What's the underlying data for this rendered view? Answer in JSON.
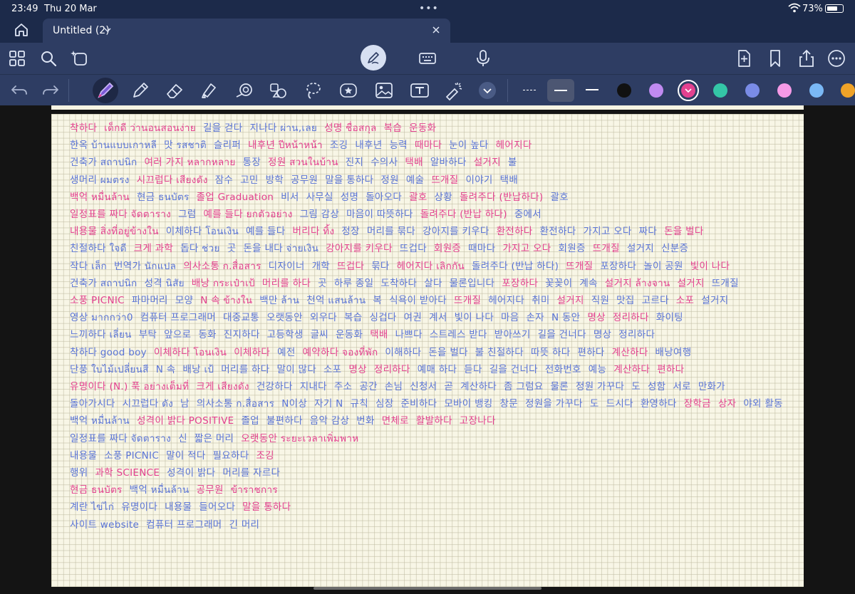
{
  "status_bar": {
    "time": "23:49",
    "date": "Thu 20 Mar",
    "battery_text": "73%",
    "battery_level": 0.73
  },
  "tab": {
    "title": "Untitled (2)"
  },
  "icons": {
    "home": "home-icon",
    "grid": "grid-icon",
    "search": "search-icon",
    "magic": "ai-icon",
    "pen_mode": "pen-icon",
    "keyboard": "keyboard-icon",
    "mic": "microphone-icon",
    "add_page": "add-page-icon",
    "bookmark": "bookmark-icon",
    "share": "share-icon",
    "more": "more-icon"
  },
  "tools": [
    "undo",
    "redo",
    "pen",
    "pencil",
    "eraser",
    "highlighter",
    "shapes",
    "elements",
    "lasso",
    "stickers",
    "image",
    "text",
    "laser"
  ],
  "stroke_widths": [
    "fine",
    "medium",
    "thick"
  ],
  "colors": {
    "black": "#111111",
    "purple": "#c08af0",
    "pink": "#e3418f",
    "teal": "#34c6a7",
    "periwinkle": "#7a8ce6",
    "light_pink": "#f59ae6",
    "light_blue": "#7ab8f5",
    "orange": "#f0a328",
    "selected": "pink",
    "ink_blue": "#5a74d6",
    "ink_pink": "#e3418f",
    "paper": "#f8f6e6"
  },
  "notes": [
    [
      {
        "t": "착하다",
        "c": "pk"
      },
      {
        "t": "เด็กดี ว่านอนสอนง่าย",
        "c": "pk"
      },
      {
        "t": "길을 걷다",
        "c": "bl"
      },
      {
        "t": "지나다 ผ่าน,เลย",
        "c": "bl"
      },
      {
        "t": "성명 ชื่อสกุล",
        "c": "pk"
      },
      {
        "t": "복습",
        "c": "pk"
      },
      {
        "t": "운동화",
        "c": "pk"
      }
    ],
    [
      {
        "t": "한옥 บ้านแบบเกาหลี",
        "c": "bl"
      },
      {
        "t": "맛 รสชาติ",
        "c": "bl"
      },
      {
        "t": "슬리퍼",
        "c": "bl"
      },
      {
        "t": "내후년 ปีหน้าหน้า",
        "c": "pk"
      },
      {
        "t": "조깅",
        "c": "bl"
      },
      {
        "t": "내후년",
        "c": "bl"
      },
      {
        "t": "능력",
        "c": "bl"
      },
      {
        "t": "때마다",
        "c": "pk"
      },
      {
        "t": "눈이 높다",
        "c": "bl"
      },
      {
        "t": "헤어지다",
        "c": "pk"
      }
    ],
    [
      {
        "t": "건축가 สถาปนิก",
        "c": "bl"
      },
      {
        "t": "여러 가지 หลากหลาย",
        "c": "pk"
      },
      {
        "t": "통장",
        "c": "bl"
      },
      {
        "t": "정원 สวนในบ้าน",
        "c": "pk"
      },
      {
        "t": "진지",
        "c": "bl"
      },
      {
        "t": "수의사",
        "c": "bl"
      },
      {
        "t": "택배",
        "c": "pk"
      },
      {
        "t": "알바하다",
        "c": "bl"
      },
      {
        "t": "설거지",
        "c": "pk"
      },
      {
        "t": "불",
        "c": "bl"
      }
    ],
    [
      {
        "t": "생머리 ผมตรง",
        "c": "bl"
      },
      {
        "t": "시끄럽다 เสียงดัง",
        "c": "pk"
      },
      {
        "t": "잠수",
        "c": "bl"
      },
      {
        "t": "고민",
        "c": "bl"
      },
      {
        "t": "방학",
        "c": "bl"
      },
      {
        "t": "공무원",
        "c": "bl"
      },
      {
        "t": "말을 통하다",
        "c": "bl"
      },
      {
        "t": "정원",
        "c": "bl"
      },
      {
        "t": "예술",
        "c": "bl"
      },
      {
        "t": "뜨개질",
        "c": "pk"
      },
      {
        "t": "이야기",
        "c": "bl"
      },
      {
        "t": "택배",
        "c": "bl"
      }
    ],
    [
      {
        "t": "백억 หมื่นล้าน",
        "c": "pk"
      },
      {
        "t": "현금 ธนบัตร",
        "c": "bl"
      },
      {
        "t": "졸업 Graduation",
        "c": "pk"
      },
      {
        "t": "비서",
        "c": "bl"
      },
      {
        "t": "사무실",
        "c": "bl"
      },
      {
        "t": "성명",
        "c": "bl"
      },
      {
        "t": "돌아오다",
        "c": "bl"
      },
      {
        "t": "괄호",
        "c": "pk"
      },
      {
        "t": "상황",
        "c": "bl"
      },
      {
        "t": "돌려주다 (반납하다)",
        "c": "pk"
      },
      {
        "t": "괄호",
        "c": "bl"
      }
    ],
    [
      {
        "t": "일정표를 짜다 จัดตาราง",
        "c": "pk"
      },
      {
        "t": "그럼",
        "c": "bl"
      },
      {
        "t": "예를 들다 ยกตัวอย่าง",
        "c": "pk"
      },
      {
        "t": "그림 감상",
        "c": "bl"
      },
      {
        "t": "마음이 따뜻하다",
        "c": "bl"
      },
      {
        "t": "돌려주다 (반납 하다)",
        "c": "pk"
      },
      {
        "t": "중에서",
        "c": "bl"
      }
    ],
    [
      {
        "t": "내용물 สิ่งที่อยู่ข้างใน",
        "c": "pk"
      },
      {
        "t": "이체하다 โอนเงิน",
        "c": "bl"
      },
      {
        "t": "예를 들다",
        "c": "bl"
      },
      {
        "t": "버리다 ทิ้ง",
        "c": "pk"
      },
      {
        "t": "정장",
        "c": "bl"
      },
      {
        "t": "머리를 묶다",
        "c": "bl"
      },
      {
        "t": "강아지를 키우다",
        "c": "bl"
      },
      {
        "t": "환전하다",
        "c": "pk"
      },
      {
        "t": "환전하다",
        "c": "bl"
      },
      {
        "t": "가지고 오다",
        "c": "bl"
      },
      {
        "t": "짜다",
        "c": "bl"
      },
      {
        "t": "돈을 벌다",
        "c": "pk"
      }
    ],
    [
      {
        "t": "친절하다 ใจดี",
        "c": "bl"
      },
      {
        "t": "크게 과학",
        "c": "pk"
      },
      {
        "t": "돕다 ช่วย",
        "c": "bl"
      },
      {
        "t": "곳",
        "c": "bl"
      },
      {
        "t": "돈을 내다 จ่ายเงิน",
        "c": "bl"
      },
      {
        "t": "강아지를 키우다",
        "c": "pk"
      },
      {
        "t": "뜨겁다",
        "c": "bl"
      },
      {
        "t": "회원증",
        "c": "pk"
      },
      {
        "t": "때마다",
        "c": "bl"
      },
      {
        "t": "가지고 오다",
        "c": "pk"
      },
      {
        "t": "회원증",
        "c": "bl"
      },
      {
        "t": "뜨개질",
        "c": "pk"
      },
      {
        "t": "설거지",
        "c": "bl"
      },
      {
        "t": "신분증",
        "c": "bl"
      }
    ],
    [
      {
        "t": "작다 เล็ก",
        "c": "bl"
      },
      {
        "t": "번역가 นักแปล",
        "c": "bl"
      },
      {
        "t": "의사소통 ก.สื่อสาร",
        "c": "pk"
      },
      {
        "t": "디자이너",
        "c": "bl"
      },
      {
        "t": "개학",
        "c": "bl"
      },
      {
        "t": "뜨겁다",
        "c": "pk"
      },
      {
        "t": "묶다",
        "c": "bl"
      },
      {
        "t": "헤어지다 เลิกกัน",
        "c": "pk"
      },
      {
        "t": "돌려주다 (반납 하다)",
        "c": "bl"
      },
      {
        "t": "뜨개질",
        "c": "pk"
      },
      {
        "t": "포장하다",
        "c": "bl"
      },
      {
        "t": "놀이 공원",
        "c": "bl"
      },
      {
        "t": "빛이 나다",
        "c": "pk"
      }
    ],
    [
      {
        "t": "건축가 สถาปนิก",
        "c": "bl"
      },
      {
        "t": "성격 นิสัย",
        "c": "bl"
      },
      {
        "t": "배낭 กระเป๋าเป้",
        "c": "pk"
      },
      {
        "t": "머리를 하다",
        "c": "pk"
      },
      {
        "t": "곳",
        "c": "bl"
      },
      {
        "t": "하루 종일",
        "c": "bl"
      },
      {
        "t": "도착하다",
        "c": "bl"
      },
      {
        "t": "살다",
        "c": "bl"
      },
      {
        "t": "물론입니다",
        "c": "bl"
      },
      {
        "t": "포장하다",
        "c": "pk"
      },
      {
        "t": "꽃꽂이",
        "c": "bl"
      },
      {
        "t": "계속",
        "c": "bl"
      },
      {
        "t": "설거지 ล้างจาน",
        "c": "pk"
      },
      {
        "t": "설거지",
        "c": "pk"
      },
      {
        "t": "뜨개질",
        "c": "bl"
      }
    ],
    [
      {
        "t": "소풍 PICNIC",
        "c": "pk"
      },
      {
        "t": "파마머리",
        "c": "bl"
      },
      {
        "t": "모양",
        "c": "bl"
      },
      {
        "t": "N 속 ข้างใน",
        "c": "pk"
      },
      {
        "t": "백만 ล้าน",
        "c": "bl"
      },
      {
        "t": "천억 แสนล้าน",
        "c": "bl"
      },
      {
        "t": "복",
        "c": "bl"
      },
      {
        "t": "식욕이 받아다",
        "c": "bl"
      },
      {
        "t": "뜨개질",
        "c": "pk"
      },
      {
        "t": "헤어지다",
        "c": "bl"
      },
      {
        "t": "취미",
        "c": "bl"
      },
      {
        "t": "설거지",
        "c": "pk"
      },
      {
        "t": "직원",
        "c": "bl"
      },
      {
        "t": "맛집",
        "c": "bl"
      },
      {
        "t": "고르다",
        "c": "bl"
      },
      {
        "t": "소포",
        "c": "pk"
      },
      {
        "t": "설거지",
        "c": "bl"
      }
    ],
    [
      {
        "t": "영상 มากกว่า0",
        "c": "bl"
      },
      {
        "t": "컴퓨터 프로그래머",
        "c": "bl"
      },
      {
        "t": "대중교통",
        "c": "bl"
      },
      {
        "t": "오랫동안",
        "c": "bl"
      },
      {
        "t": "외우다",
        "c": "bl"
      },
      {
        "t": "복습",
        "c": "bl"
      },
      {
        "t": "싱겁다",
        "c": "bl"
      },
      {
        "t": "여권",
        "c": "bl"
      },
      {
        "t": "계서",
        "c": "bl"
      },
      {
        "t": "빛이 나다",
        "c": "bl"
      },
      {
        "t": "마음",
        "c": "bl"
      },
      {
        "t": "손자",
        "c": "bl"
      },
      {
        "t": "N 동안",
        "c": "bl"
      },
      {
        "t": "명상",
        "c": "pk"
      },
      {
        "t": "정리하다",
        "c": "pk"
      },
      {
        "t": "화이팅",
        "c": "bl"
      }
    ],
    [
      {
        "t": "느끼하다 เลี่ยน",
        "c": "bl"
      },
      {
        "t": "부탁",
        "c": "bl"
      },
      {
        "t": "앞으로",
        "c": "bl"
      },
      {
        "t": "동화",
        "c": "bl"
      },
      {
        "t": "진지하다",
        "c": "bl"
      },
      {
        "t": "고등학생",
        "c": "bl"
      },
      {
        "t": "글씨",
        "c": "bl"
      },
      {
        "t": "운동화",
        "c": "bl"
      },
      {
        "t": "택배",
        "c": "pk"
      },
      {
        "t": "나쁘다",
        "c": "bl"
      },
      {
        "t": "스트레스 받다",
        "c": "bl"
      },
      {
        "t": "받아쓰기",
        "c": "bl"
      },
      {
        "t": "길을 건너다",
        "c": "bl"
      },
      {
        "t": "명상",
        "c": "bl"
      },
      {
        "t": "정리하다",
        "c": "bl"
      }
    ],
    [
      {
        "t": "착하다 good boy",
        "c": "bl"
      },
      {
        "t": "이체하다 โอนเงิน",
        "c": "pk"
      },
      {
        "t": "이체하다",
        "c": "pk"
      },
      {
        "t": "예전",
        "c": "bl"
      },
      {
        "t": "예약하다 จองที่พัก",
        "c": "pk"
      },
      {
        "t": "이해하다",
        "c": "bl"
      },
      {
        "t": "돈을 벌다",
        "c": "bl"
      },
      {
        "t": "불 친절하다",
        "c": "bl"
      },
      {
        "t": "따뜻 하다",
        "c": "bl"
      },
      {
        "t": "편하다",
        "c": "bl"
      },
      {
        "t": "계산하다",
        "c": "pk"
      },
      {
        "t": "배낭여행",
        "c": "bl"
      }
    ],
    [
      {
        "t": "단풍 ใบไม้เปลี่ยนสี",
        "c": "bl"
      },
      {
        "t": "N 속",
        "c": "bl"
      },
      {
        "t": "배낭 เป้",
        "c": "bl"
      },
      {
        "t": "머리를 하다",
        "c": "bl"
      },
      {
        "t": "말이 많다",
        "c": "bl"
      },
      {
        "t": "소포",
        "c": "bl"
      },
      {
        "t": "명상",
        "c": "pk"
      },
      {
        "t": "정리하다",
        "c": "pk"
      },
      {
        "t": "예매 하다",
        "c": "bl"
      },
      {
        "t": "듣다",
        "c": "bl"
      },
      {
        "t": "길을 건너다",
        "c": "bl"
      },
      {
        "t": "전화번호",
        "c": "bl"
      },
      {
        "t": "예능",
        "c": "bl"
      },
      {
        "t": "계산하다",
        "c": "pk"
      },
      {
        "t": "편하다",
        "c": "pk"
      }
    ],
    [
      {
        "t": "유명이다 (N.) 푹 อย่างเต็มที่",
        "c": "pk"
      },
      {
        "t": "크게 เสียงดัง",
        "c": "pk"
      },
      {
        "t": "건강하다",
        "c": "bl"
      },
      {
        "t": "지내다",
        "c": "bl"
      },
      {
        "t": "주소",
        "c": "bl"
      },
      {
        "t": "공간",
        "c": "bl"
      },
      {
        "t": "손님",
        "c": "bl"
      },
      {
        "t": "신청서",
        "c": "bl"
      },
      {
        "t": "곧",
        "c": "bl"
      },
      {
        "t": "계산하다",
        "c": "bl"
      },
      {
        "t": "좀 그럼요",
        "c": "bl"
      },
      {
        "t": "물론",
        "c": "bl"
      },
      {
        "t": "정원 가꾸다",
        "c": "bl"
      },
      {
        "t": "도",
        "c": "bl"
      },
      {
        "t": "성함",
        "c": "bl"
      },
      {
        "t": "서로",
        "c": "bl"
      },
      {
        "t": "만화가",
        "c": "bl"
      }
    ],
    [
      {
        "t": "돌아가시다",
        "c": "bl"
      },
      {
        "t": "시끄럽다 ดัง",
        "c": "bl"
      },
      {
        "t": "남",
        "c": "bl"
      },
      {
        "t": "의사소통 ก.สื่อสาร",
        "c": "bl"
      },
      {
        "t": "N이상",
        "c": "bl"
      },
      {
        "t": "자기 N",
        "c": "bl"
      },
      {
        "t": "규칙",
        "c": "bl"
      },
      {
        "t": "심장",
        "c": "bl"
      },
      {
        "t": "준비하다",
        "c": "bl"
      },
      {
        "t": "모바이 뱅킹",
        "c": "bl"
      },
      {
        "t": "창문",
        "c": "bl"
      },
      {
        "t": "정원을 가꾸다",
        "c": "bl"
      },
      {
        "t": "도",
        "c": "bl"
      },
      {
        "t": "드시다",
        "c": "bl"
      },
      {
        "t": "환영하다",
        "c": "bl"
      },
      {
        "t": "장학금",
        "c": "pk"
      },
      {
        "t": "상자",
        "c": "pk"
      },
      {
        "t": "야외 활동",
        "c": "bl"
      }
    ],
    [
      {
        "t": "백억 หมื่นล้าน",
        "c": "bl"
      },
      {
        "t": "성격이 밝다 POSITIVE",
        "c": "pk"
      },
      {
        "t": "졸업",
        "c": "bl"
      },
      {
        "t": "불편하다",
        "c": "bl"
      },
      {
        "t": "음악 감상",
        "c": "bl"
      },
      {
        "t": "번화",
        "c": "bl"
      },
      {
        "t": "면체로",
        "c": "pk"
      },
      {
        "t": "활발하다",
        "c": "pk"
      },
      {
        "t": "고장나다",
        "c": "pk"
      }
    ],
    [
      {
        "t": "일정표를 짜다 จัดตาราง",
        "c": "bl"
      },
      {
        "t": "신",
        "c": "bl"
      },
      {
        "t": "짧은 머리",
        "c": "bl"
      },
      {
        "t": "오랫동안 ระยะเวลาเพิ่มพาห",
        "c": "pk"
      }
    ],
    [
      {
        "t": "내용물",
        "c": "bl"
      },
      {
        "t": "소풍 PICNIC",
        "c": "bl"
      },
      {
        "t": "말이 적다",
        "c": "bl"
      },
      {
        "t": "필요하다",
        "c": "bl"
      },
      {
        "t": "조깅",
        "c": "pk"
      }
    ],
    [
      {
        "t": "행위",
        "c": "bl"
      },
      {
        "t": "과학 SCIENCE",
        "c": "pk"
      },
      {
        "t": "성격이 밝다",
        "c": "bl"
      },
      {
        "t": "머리를 자르다",
        "c": "bl"
      }
    ],
    [
      {
        "t": "현금 ธนบัตร",
        "c": "pk"
      },
      {
        "t": "백억 หมื่นล้าน",
        "c": "bl"
      },
      {
        "t": "공무원",
        "c": "pk"
      },
      {
        "t": "ข้าราชการ",
        "c": "pk"
      }
    ],
    [
      {
        "t": "계란 ไข่ไก่",
        "c": "bl"
      },
      {
        "t": "유명이다",
        "c": "bl"
      },
      {
        "t": "내용물",
        "c": "bl"
      },
      {
        "t": "들어오다",
        "c": "bl"
      },
      {
        "t": "말을 통하다",
        "c": "pk"
      }
    ],
    [
      {
        "t": "사이트 website",
        "c": "bl"
      },
      {
        "t": "컴퓨터 프로그래머",
        "c": "bl"
      },
      {
        "t": "긴 머리",
        "c": "bl"
      }
    ]
  ]
}
